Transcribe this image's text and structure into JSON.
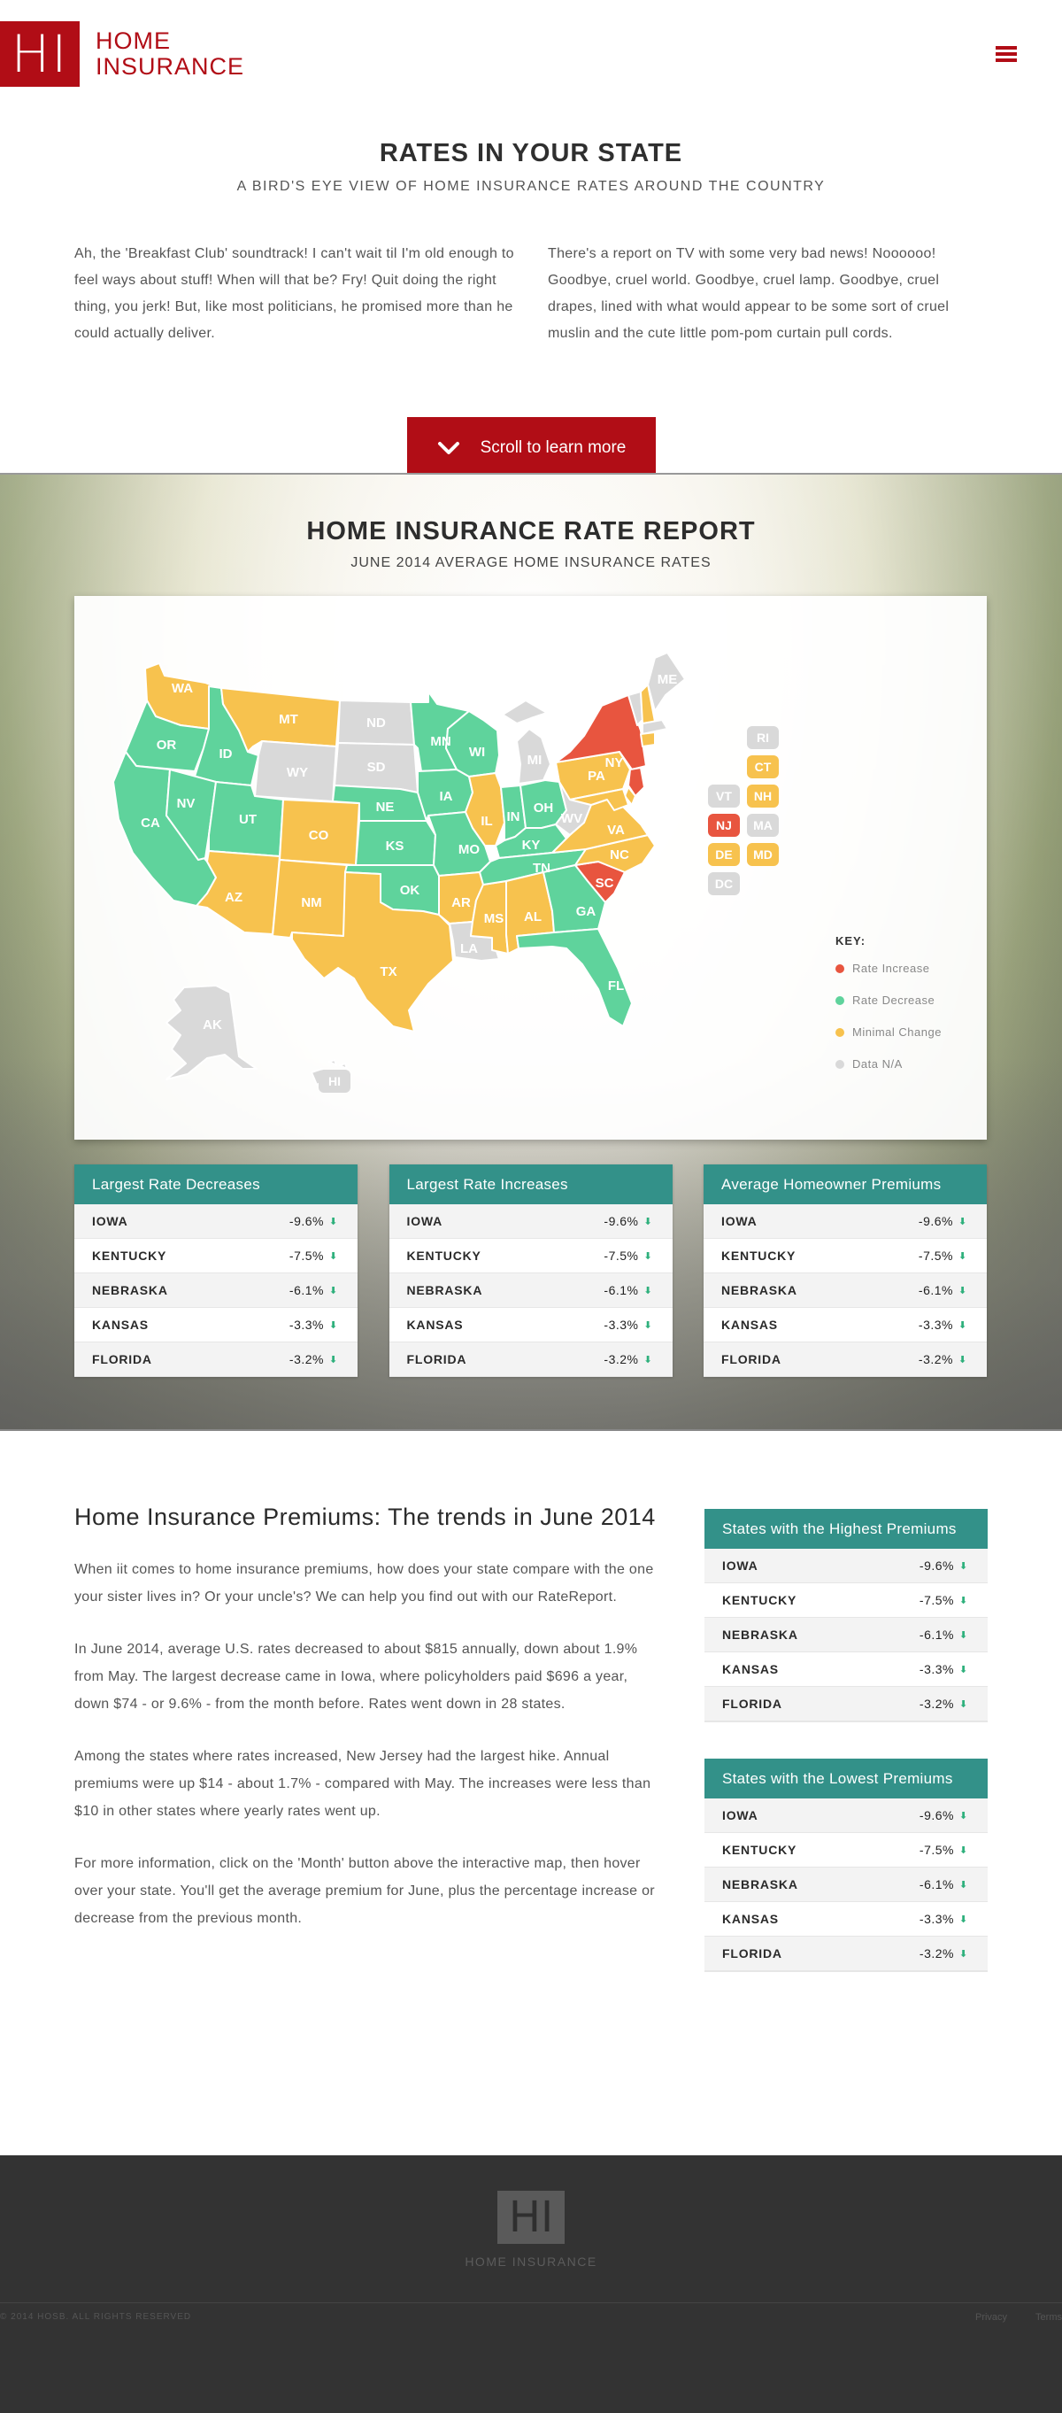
{
  "header": {
    "logo_mark": "HI",
    "logo_line1": "HOME",
    "logo_line2": "INSURANCE",
    "brand_color": "#b10d16"
  },
  "intro": {
    "title": "RATES IN YOUR STATE",
    "subtitle": "A BIRD'S EYE VIEW OF HOME INSURANCE RATES AROUND THE COUNTRY",
    "col_left": "Ah, the 'Breakfast Club' soundtrack! I can't wait til I'm old enough to feel ways about stuff! When will that be? Fry! Quit doing the right thing, you jerk! But, like most politicians, he promised more than he could actually deliver.",
    "col_right": "There's a report on TV with some very bad news! Noooooo! Goodbye, cruel world. Goodbye, cruel lamp. Goodbye, cruel drapes, lined with what would appear to be some sort of cruel muslin and the cute little pom-pom curtain pull cords.",
    "scroll_label": "Scroll to learn more"
  },
  "report": {
    "title": "HOME INSURANCE RATE REPORT",
    "subtitle": "JUNE 2014 AVERAGE HOME INSURANCE RATES",
    "colors": {
      "increase": "#e8553f",
      "decrease": "#5fd39c",
      "minimal": "#f7c24e",
      "na": "#d9d9d9"
    },
    "key": {
      "title": "KEY:",
      "increase": "Rate Increase",
      "decrease": "Rate Decrease",
      "minimal": "Minimal Change",
      "na": "Data N/A"
    },
    "states": {
      "WA": "WA",
      "OR": "OR",
      "CA": "CA",
      "ID": "ID",
      "NV": "NV",
      "MT": "MT",
      "WY": "WY",
      "UT": "UT",
      "AZ": "AZ",
      "CO": "CO",
      "NM": "NM",
      "ND": "ND",
      "SD": "SD",
      "NE": "NE",
      "KS": "KS",
      "OK": "OK",
      "TX": "TX",
      "MN": "MN",
      "IA": "IA",
      "MO": "MO",
      "AR": "AR",
      "LA": "LA",
      "WI": "WI",
      "IL": "IL",
      "MS": "MS",
      "MI": "MI",
      "IN": "IN",
      "KY": "KY",
      "TN": "TN",
      "AL": "AL",
      "OH": "OH",
      "WV": "WV",
      "GA": "GA",
      "FL": "FL",
      "SC": "SC",
      "NC": "NC",
      "VA": "VA",
      "PA": "PA",
      "NY": "NY",
      "ME": "ME",
      "AK": "AK",
      "HI": "HI",
      "RI": "RI",
      "CT": "CT",
      "VT": "VT",
      "NH": "NH",
      "NJ": "NJ",
      "MA": "MA",
      "DE": "DE",
      "MD": "MD",
      "DC": "DC"
    },
    "tables": [
      {
        "title": "Largest Rate Decreases",
        "rows": [
          {
            "name": "IOWA",
            "value": "-9.6%"
          },
          {
            "name": "KENTUCKY",
            "value": "-7.5%"
          },
          {
            "name": "NEBRASKA",
            "value": "-6.1%"
          },
          {
            "name": "KANSAS",
            "value": "-3.3%"
          },
          {
            "name": "FLORIDA",
            "value": "-3.2%"
          }
        ]
      },
      {
        "title": "Largest Rate Increases",
        "rows": [
          {
            "name": "IOWA",
            "value": "-9.6%"
          },
          {
            "name": "KENTUCKY",
            "value": "-7.5%"
          },
          {
            "name": "NEBRASKA",
            "value": "-6.1%"
          },
          {
            "name": "KANSAS",
            "value": "-3.3%"
          },
          {
            "name": "FLORIDA",
            "value": "-3.2%"
          }
        ]
      },
      {
        "title": "Average Homeowner Premiums",
        "rows": [
          {
            "name": "IOWA",
            "value": "-9.6%"
          },
          {
            "name": "KENTUCKY",
            "value": "-7.5%"
          },
          {
            "name": "NEBRASKA",
            "value": "-6.1%"
          },
          {
            "name": "KANSAS",
            "value": "-3.3%"
          },
          {
            "name": "FLORIDA",
            "value": "-3.2%"
          }
        ]
      }
    ]
  },
  "article": {
    "title": "Home Insurance Premiums: The trends in June 2014",
    "p1": "When iit comes to home insurance premiums, how does your state compare with the one your sister lives in? Or your uncle's? We can help you find out with our RateReport.",
    "p2": "In June 2014, average U.S. rates decreased to about $815 annually, down about 1.9% from May. The largest decrease came in Iowa, where policyholders paid $696 a year, down $74 - or 9.6% - from the month before. Rates went down in 28 states.",
    "p3": "Among the states where rates increased, New Jersey had the largest hike. Annual premiums were up $14 - about 1.7% - compared with May. The increases were less than $10 in other states where yearly rates went up.",
    "p4": "For more information, click on the 'Month' button above the interactive map, then hover over your state. You'll get the average premium for June, plus the percentage increase or decrease from the previous month.",
    "side_tables": [
      {
        "title": "States with the Highest Premiums",
        "rows": [
          {
            "name": "IOWA",
            "value": "-9.6%"
          },
          {
            "name": "KENTUCKY",
            "value": "-7.5%"
          },
          {
            "name": "NEBRASKA",
            "value": "-6.1%"
          },
          {
            "name": "KANSAS",
            "value": "-3.3%"
          },
          {
            "name": "FLORIDA",
            "value": "-3.2%"
          }
        ]
      },
      {
        "title": "States with the Lowest Premiums",
        "rows": [
          {
            "name": "IOWA",
            "value": "-9.6%"
          },
          {
            "name": "KENTUCKY",
            "value": "-7.5%"
          },
          {
            "name": "NEBRASKA",
            "value": "-6.1%"
          },
          {
            "name": "KANSAS",
            "value": "-3.3%"
          },
          {
            "name": "FLORIDA",
            "value": "-3.2%"
          }
        ]
      }
    ]
  },
  "footer": {
    "logo_mark": "HI",
    "name": "HOME INSURANCE",
    "copyright": "© 2014 HOSB. ALL RIGHTS RESERVED",
    "links": [
      "Privacy",
      "Terms"
    ]
  }
}
